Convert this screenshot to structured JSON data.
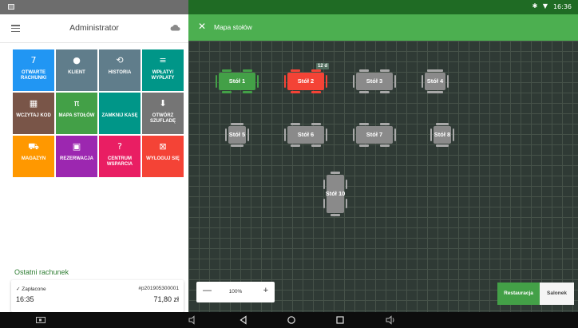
{
  "status": {
    "time": "16:36",
    "system_icons": "✱ ▼"
  },
  "left_panel": {
    "title": "Administrator",
    "tiles": [
      {
        "icon": "7",
        "label": "OTWARTE RACHUNKI",
        "color": "#2196f3"
      },
      {
        "icon": "●",
        "label": "KLIENT",
        "color": "#607d8b"
      },
      {
        "icon": "⟲",
        "label": "HISTORIA",
        "color": "#607d8b"
      },
      {
        "icon": "≡",
        "label": "WPŁATY/ WYPŁATY",
        "color": "#009688"
      },
      {
        "icon": "▦",
        "label": "WCZYTAJ KOD",
        "color": "#795548"
      },
      {
        "icon": "π",
        "label": "MAPA STOŁÓW",
        "color": "#43a047"
      },
      {
        "icon": "",
        "label": "ZAMKNIJ KASĘ",
        "color": "#009688"
      },
      {
        "icon": "⬇",
        "label": "OTWÓRZ SZUFLADĘ",
        "color": "#757575"
      },
      {
        "icon": "⛟",
        "label": "MAGAZYN",
        "color": "#ff9800"
      },
      {
        "icon": "▣",
        "label": "REZERWACJA",
        "color": "#9c27b0"
      },
      {
        "icon": "?",
        "label": "CENTRUM WSPARCIA",
        "color": "#e91e63"
      },
      {
        "icon": "⊠",
        "label": "WYLOGUJ SIĘ",
        "color": "#f44336"
      }
    ],
    "last_receipt": {
      "section_title": "Ostatni rachunek",
      "status": "✓ Zapłacone",
      "number": "#p201905300001",
      "time": "16:35",
      "amount": "71,80 zł"
    }
  },
  "map": {
    "title": "Mapa stołów",
    "tables": [
      {
        "label": "Stół 1",
        "state": "occupied",
        "color": "#43a047"
      },
      {
        "label": "Stół 2",
        "state": "alert",
        "color": "#f44336",
        "badge": "12 d"
      },
      {
        "label": "Stół 3",
        "state": "free",
        "color": "#8a8a8a"
      },
      {
        "label": "Stół 4",
        "state": "free",
        "color": "#8a8a8a"
      },
      {
        "label": "Stół 5",
        "state": "free",
        "color": "#8a8a8a"
      },
      {
        "label": "Stół 6",
        "state": "free",
        "color": "#8a8a8a"
      },
      {
        "label": "Stół 7",
        "state": "free",
        "color": "#8a8a8a"
      },
      {
        "label": "Stół 8",
        "state": "free",
        "color": "#8a8a8a"
      },
      {
        "label": "Stół 10",
        "state": "free",
        "color": "#8a8a8a"
      }
    ],
    "zoom": {
      "minus": "—",
      "value": "100%",
      "plus": "+"
    },
    "rooms": {
      "active": "Restauracja",
      "inactive": "Salonek"
    }
  }
}
